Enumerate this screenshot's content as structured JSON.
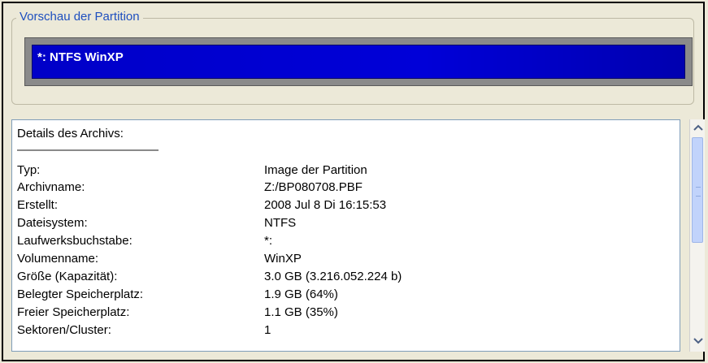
{
  "preview": {
    "title": "Vorschau der Partition",
    "partition_label": "*: NTFS WinXP"
  },
  "details": {
    "heading": "Details des Archivs:",
    "rows": [
      {
        "label": "Typ:",
        "value": "Image der Partition"
      },
      {
        "label": "Archivname:",
        "value": "Z:/BP080708.PBF"
      },
      {
        "label": "Erstellt:",
        "value": "2008 Jul 8 Di 16:15:53"
      },
      {
        "label": "Dateisystem:",
        "value": "NTFS"
      },
      {
        "label": "Laufwerksbuchstabe:",
        "value": "*:"
      },
      {
        "label": "Volumenname:",
        "value": "WinXP"
      },
      {
        "label": "Größe (Kapazität):",
        "value": "3.0 GB (3.216.052.224 b)"
      },
      {
        "label": "Belegter Speicherplatz:",
        "value": "1.9 GB (64%)"
      },
      {
        "label": "Freier Speicherplatz:",
        "value": "1.1 GB (35%)"
      },
      {
        "label": "Sektoren/Cluster:",
        "value": "1"
      }
    ]
  },
  "scrollbar": {
    "up_icon": "chevron-up-icon",
    "down_icon": "chevron-down-icon"
  }
}
